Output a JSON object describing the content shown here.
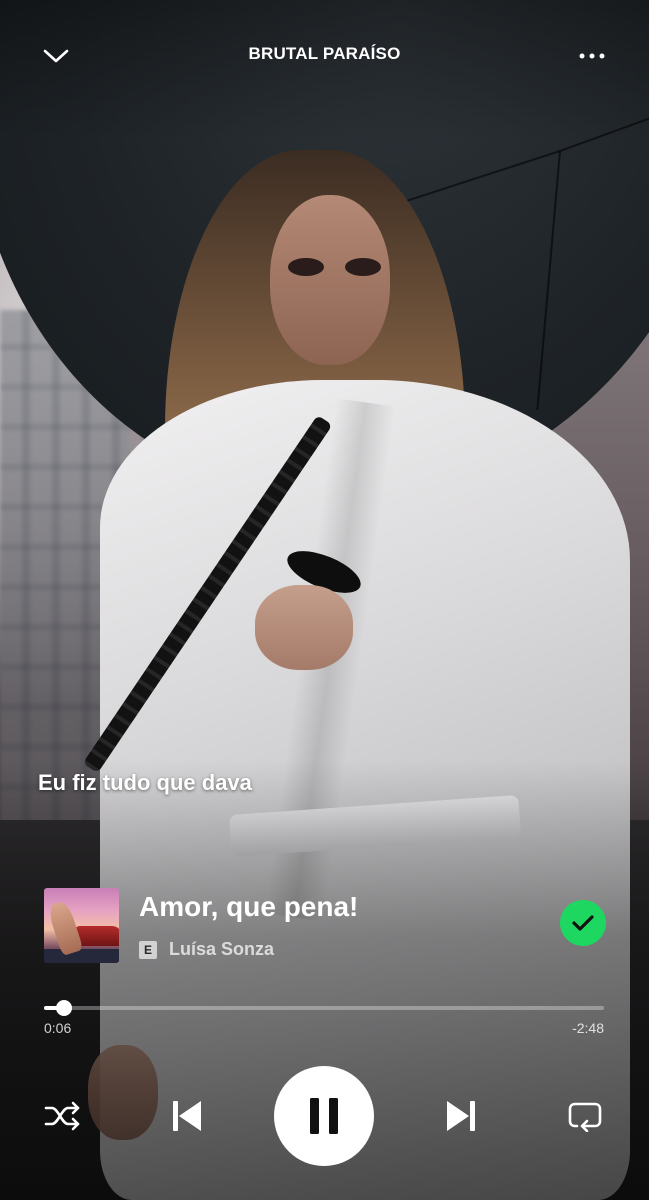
{
  "header": {
    "context_title": "BRUTAL PARAÍSO",
    "collapse_icon": "chevron-down-icon",
    "more_icon": "more-horizontal-icon"
  },
  "lyrics": {
    "current_line": "Eu fiz tudo que dava"
  },
  "track": {
    "title": "Amor, que pena!",
    "artist": "Luísa Sonza",
    "explicit_badge": "E",
    "liked": true,
    "liked_color": "#1ed760"
  },
  "playback": {
    "elapsed": "0:06",
    "remaining": "-2:48",
    "progress_fraction": 0.035,
    "is_playing": true
  },
  "controls": {
    "shuffle_icon": "shuffle-icon",
    "previous_icon": "skip-previous-icon",
    "pause_icon": "pause-icon",
    "next_icon": "skip-next-icon",
    "repeat_icon": "repeat-icon"
  }
}
